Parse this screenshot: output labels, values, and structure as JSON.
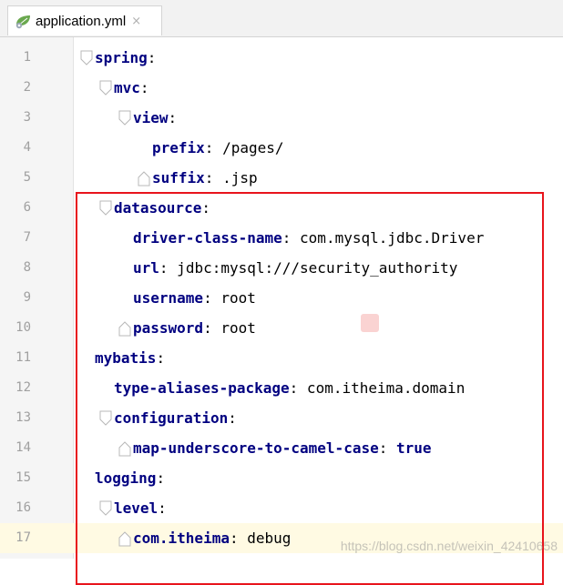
{
  "tab": {
    "icon": "yaml-leaf-icon",
    "filename": "application.yml",
    "close_glyph": "×"
  },
  "editor": {
    "current_line": 17,
    "lines": [
      {
        "num": "1",
        "indent": 0,
        "key": "spring",
        "colon": ":",
        "value": ""
      },
      {
        "num": "2",
        "indent": 1,
        "key": "mvc",
        "colon": ":",
        "value": ""
      },
      {
        "num": "3",
        "indent": 2,
        "key": "view",
        "colon": ":",
        "value": ""
      },
      {
        "num": "4",
        "indent": 3,
        "key": "prefix",
        "colon": ":",
        "value": " /pages/"
      },
      {
        "num": "5",
        "indent": 3,
        "key": "suffix",
        "colon": ":",
        "value": " .jsp"
      },
      {
        "num": "6",
        "indent": 1,
        "key": "datasource",
        "colon": ":",
        "value": ""
      },
      {
        "num": "7",
        "indent": 2,
        "key": "driver-class-name",
        "colon": ":",
        "value": " com.mysql.jdbc.Driver"
      },
      {
        "num": "8",
        "indent": 2,
        "key": "url",
        "colon": ":",
        "value": " jdbc:mysql:///security_authority"
      },
      {
        "num": "9",
        "indent": 2,
        "key": "username",
        "colon": ":",
        "value": " root"
      },
      {
        "num": "10",
        "indent": 2,
        "key": "password",
        "colon": ":",
        "value": " root"
      },
      {
        "num": "11",
        "indent": 0,
        "key": "mybatis",
        "colon": ":",
        "value": ""
      },
      {
        "num": "12",
        "indent": 1,
        "key": "type-aliases-package",
        "colon": ":",
        "value": " com.itheima.domain"
      },
      {
        "num": "13",
        "indent": 1,
        "key": "configuration",
        "colon": ":",
        "value": ""
      },
      {
        "num": "14",
        "indent": 2,
        "key": "map-underscore-to-camel-case",
        "colon": ":",
        "value": " true"
      },
      {
        "num": "15",
        "indent": 0,
        "key": "logging",
        "colon": ":",
        "value": ""
      },
      {
        "num": "16",
        "indent": 1,
        "key": "level",
        "colon": ":",
        "value": ""
      },
      {
        "num": "17",
        "indent": 2,
        "key": "com.itheima",
        "colon": ":",
        "value": " debug"
      }
    ]
  },
  "watermark": "https://blog.csdn.net/weixin_42410658",
  "colors": {
    "key": "#000080",
    "highlight_border": "#e8141c",
    "current_line_bg": "#fffae3"
  }
}
